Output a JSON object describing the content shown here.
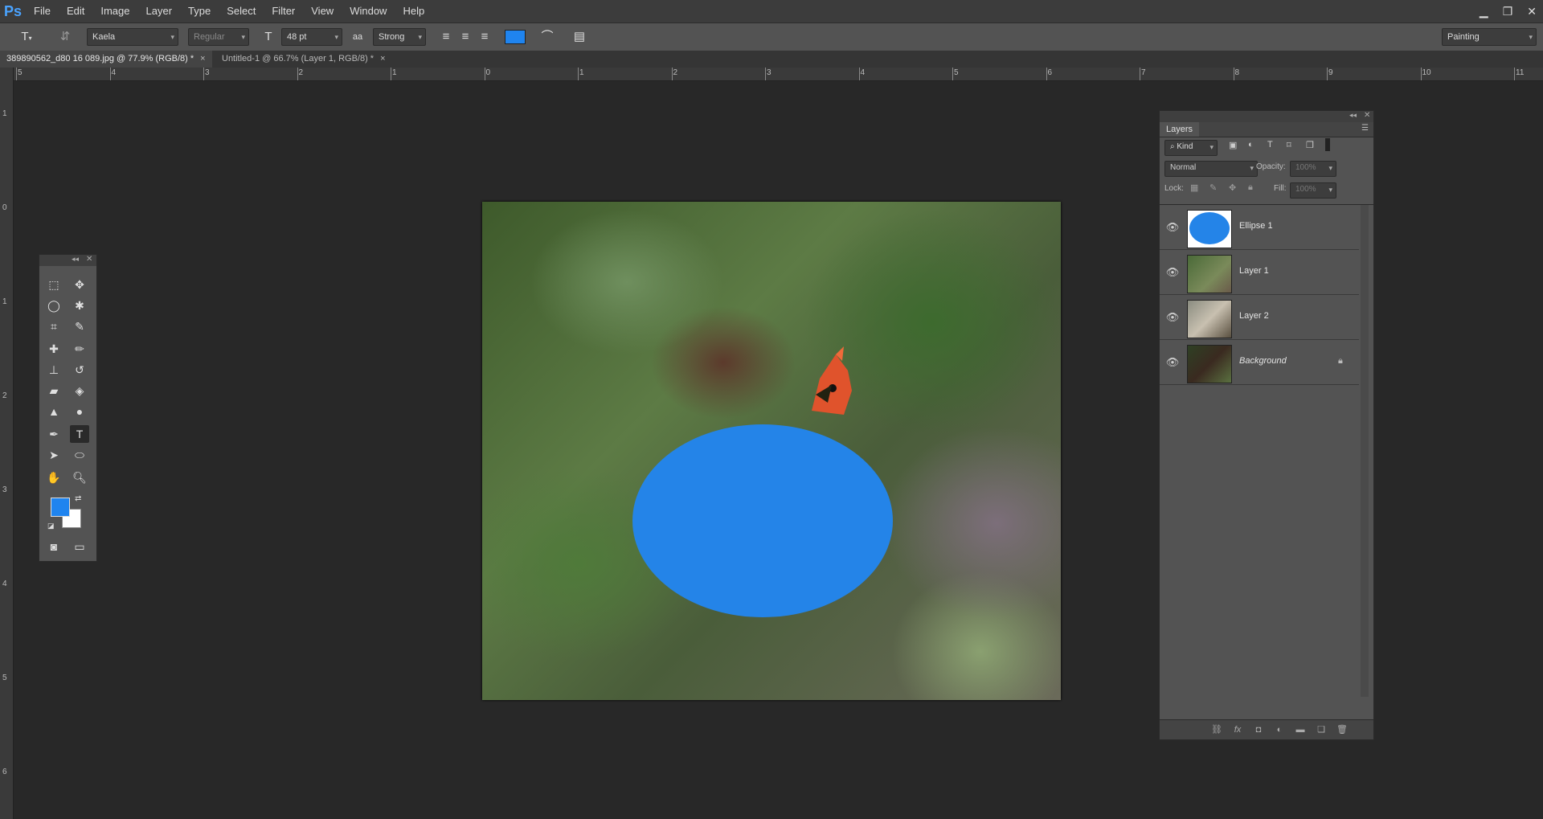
{
  "app": {
    "logo": "Ps"
  },
  "menu": {
    "items": [
      "File",
      "Edit",
      "Image",
      "Layer",
      "Type",
      "Select",
      "Filter",
      "View",
      "Window",
      "Help"
    ]
  },
  "window_controls": {
    "minimize": "▁",
    "restore": "❐",
    "close": "✕"
  },
  "options": {
    "font_family": "Kaela",
    "font_style": "Regular",
    "font_size": "48 pt",
    "antialias_label": "aa",
    "antialias": "Strong",
    "text_color": "#1f84ef",
    "workspace": "Painting"
  },
  "tabs": [
    {
      "label": "389890562_d80 16 089.jpg @ 77.9% (RGB/8) *",
      "close": "×"
    },
    {
      "label": "Untitled-1 @ 66.7% (Layer 1, RGB/8) *",
      "close": "×"
    }
  ],
  "ruler_top": [
    "5",
    "4",
    "3",
    "2",
    "1",
    "0",
    "1",
    "2",
    "3",
    "4",
    "5",
    "6",
    "7",
    "8",
    "9",
    "10",
    "11"
  ],
  "ruler_left": [
    "1",
    "0",
    "1",
    "2",
    "3",
    "4",
    "5",
    "6"
  ],
  "canvas": {
    "ellipse_color": "#2484e8"
  },
  "tools": {
    "icons": [
      "marquee-icon",
      "move-icon",
      "lasso-icon",
      "magic-wand-icon",
      "crop-icon",
      "eyedropper-icon",
      "healing-brush-icon",
      "brush-icon",
      "clone-stamp-icon",
      "history-brush-icon",
      "eraser-icon",
      "paint-bucket-icon",
      "blur-icon",
      "dodge-icon",
      "pen-icon",
      "type-icon",
      "path-selection-icon",
      "ellipse-shape-icon",
      "hand-icon",
      "zoom-icon"
    ],
    "foreground_color": "#1f84ef",
    "background_color": "#ffffff"
  },
  "layers": {
    "panel_title": "Layers",
    "filter_kind": "Kind",
    "blend_mode": "Normal",
    "opacity_label": "Opacity:",
    "opacity_value": "100%",
    "lock_label": "Lock:",
    "fill_label": "Fill:",
    "fill_value": "100%",
    "items": [
      {
        "name": "Ellipse 1"
      },
      {
        "name": "Layer 1"
      },
      {
        "name": "Layer 2"
      },
      {
        "name": "Background"
      }
    ]
  }
}
